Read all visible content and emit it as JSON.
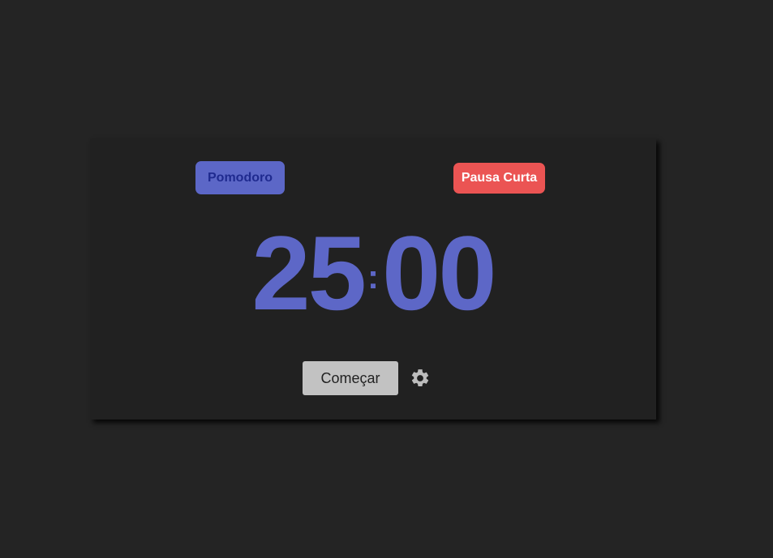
{
  "modes": {
    "pomodoro_label": "Pomodoro",
    "short_break_label": "Pausa Curta"
  },
  "timer": {
    "minutes": "25",
    "separator": ":",
    "seconds": "00"
  },
  "controls": {
    "start_label": "Começar",
    "settings_icon": "gear-icon"
  },
  "colors": {
    "background": "#242424",
    "card": "#212121",
    "accent": "#5c67c7",
    "short_break": "#eb5453",
    "start_button": "#c2c2c2",
    "gear": "#bdbdbd"
  }
}
